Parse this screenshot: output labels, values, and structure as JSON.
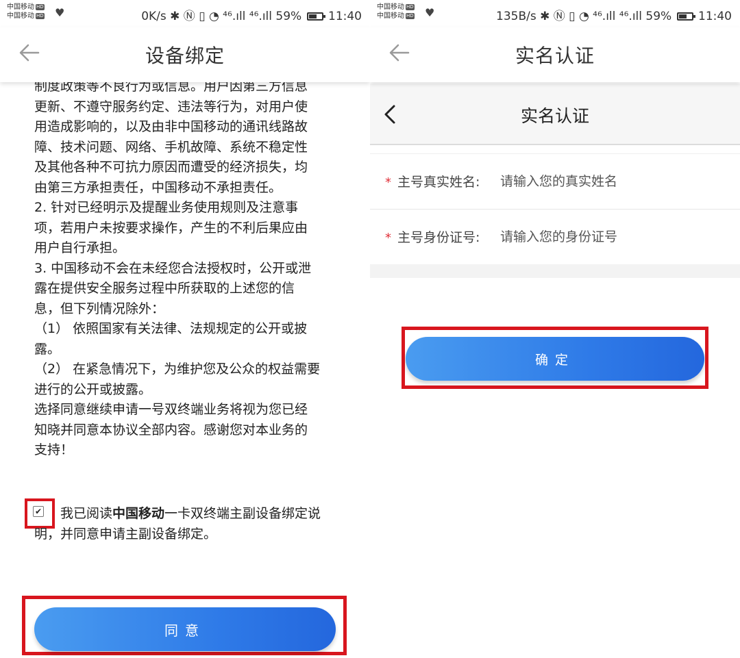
{
  "left": {
    "status": {
      "carrier1": "中国移动",
      "carrier2": "中国移动",
      "hd": "HD",
      "right": "0K/s ✱ Ⓝ ▯ ◔ ⁴⁶.ıll ⁴⁶.ıll 59%",
      "time": "11:40"
    },
    "header_title": "设备绑定",
    "agreement_lines": [
      "制度政策等不良行为或信息。用户因第三方信息",
      "更新、不遵守服务约定、违法等行为，对用户使",
      "用造成影响的，以及由非中国移动的通讯线路故",
      "障、技术问题、网络、手机故障、系统不稳定性",
      "及其他各种不可抗力原因而遭受的经济损失，均",
      "由第三方承担责任，中国移动不承担责任。",
      "2. 针对已经明示及提醒业务使用规则及注意事",
      "项，若用户未按要求操作，产生的不利后果应由",
      "用户自行承担。",
      "3. 中国移动不会在未经您合法授权时，公开或泄",
      "露在提供安全服务过程中所获取的上述您的信",
      "息，但下列情况除外：",
      "（1） 依照国家有关法律、法规规定的公开或披",
      "露。",
      "（2） 在紧急情况下，为维护您及公众的权益需要",
      "进行的公开或披露。",
      "选择同意继续申请一号双终端业务将视为您已经",
      "知晓并同意本协议全部内容。感谢您对本业务的",
      "支持！"
    ],
    "consent_prefix": "我已阅读",
    "consent_bold": "中国移动",
    "consent_suffix": "一卡双终端主副设备绑定说明，并同意申请主副设备绑定。",
    "agree_button": "同意"
  },
  "right": {
    "status": {
      "carrier1": "中国移动",
      "carrier2": "中国移动",
      "hd": "HD",
      "right": "135B/s ✱ Ⓝ ▯ ◔ ⁴⁶.ıll ⁴⁶.ıll 59%",
      "time": "11:40"
    },
    "header_title": "实名认证",
    "inner_title": "实名认证",
    "fields": [
      {
        "label": "主号真实姓名:",
        "placeholder": "请输入您的真实姓名"
      },
      {
        "label": "主号身份证号:",
        "placeholder": "请输入您的身份证号"
      }
    ],
    "confirm_button": "确定"
  },
  "colors": {
    "highlight": "#d8161e",
    "button_blue": "#2f7be8",
    "required_star": "#e0313a"
  }
}
